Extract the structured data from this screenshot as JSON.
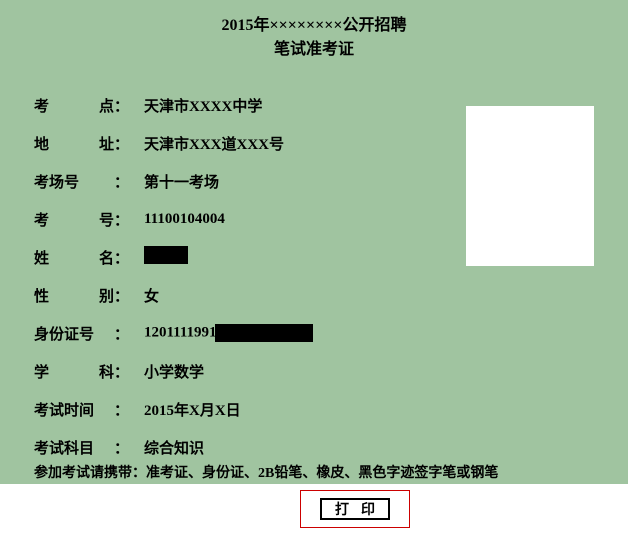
{
  "header": {
    "title_line1": "2015年××××××××公开招聘",
    "title_line2": "笔试准考证"
  },
  "fields": {
    "exam_point": {
      "label_chars": [
        "考",
        "点"
      ],
      "value": "天津市XXXX中学"
    },
    "address": {
      "label_chars": [
        "地",
        "址"
      ],
      "value": "天津市XXX道XXX号"
    },
    "room": {
      "label": "考场号",
      "value": "第十一考场"
    },
    "number": {
      "label_chars": [
        "考",
        "号"
      ],
      "value": "11100104004"
    },
    "name": {
      "label_chars": [
        "姓",
        "名"
      ],
      "value_hidden": true
    },
    "gender": {
      "label_chars": [
        "性",
        "别"
      ],
      "value": "女"
    },
    "id_card": {
      "label": "身份证号",
      "value_prefix": "1201111991",
      "suffix_hidden": true
    },
    "subject": {
      "label_chars": [
        "学",
        "科"
      ],
      "value": "小学数学"
    },
    "exam_time": {
      "label": "考试时间",
      "value": "2015年X月X日"
    },
    "exam_subject": {
      "label": "考试科目",
      "value": "综合知识"
    }
  },
  "notice": "参加考试请携带：准考证、身份证、2B铅笔、橡皮、黑色字迹签字笔或钢笔",
  "footer": {
    "print_label": "打印"
  }
}
